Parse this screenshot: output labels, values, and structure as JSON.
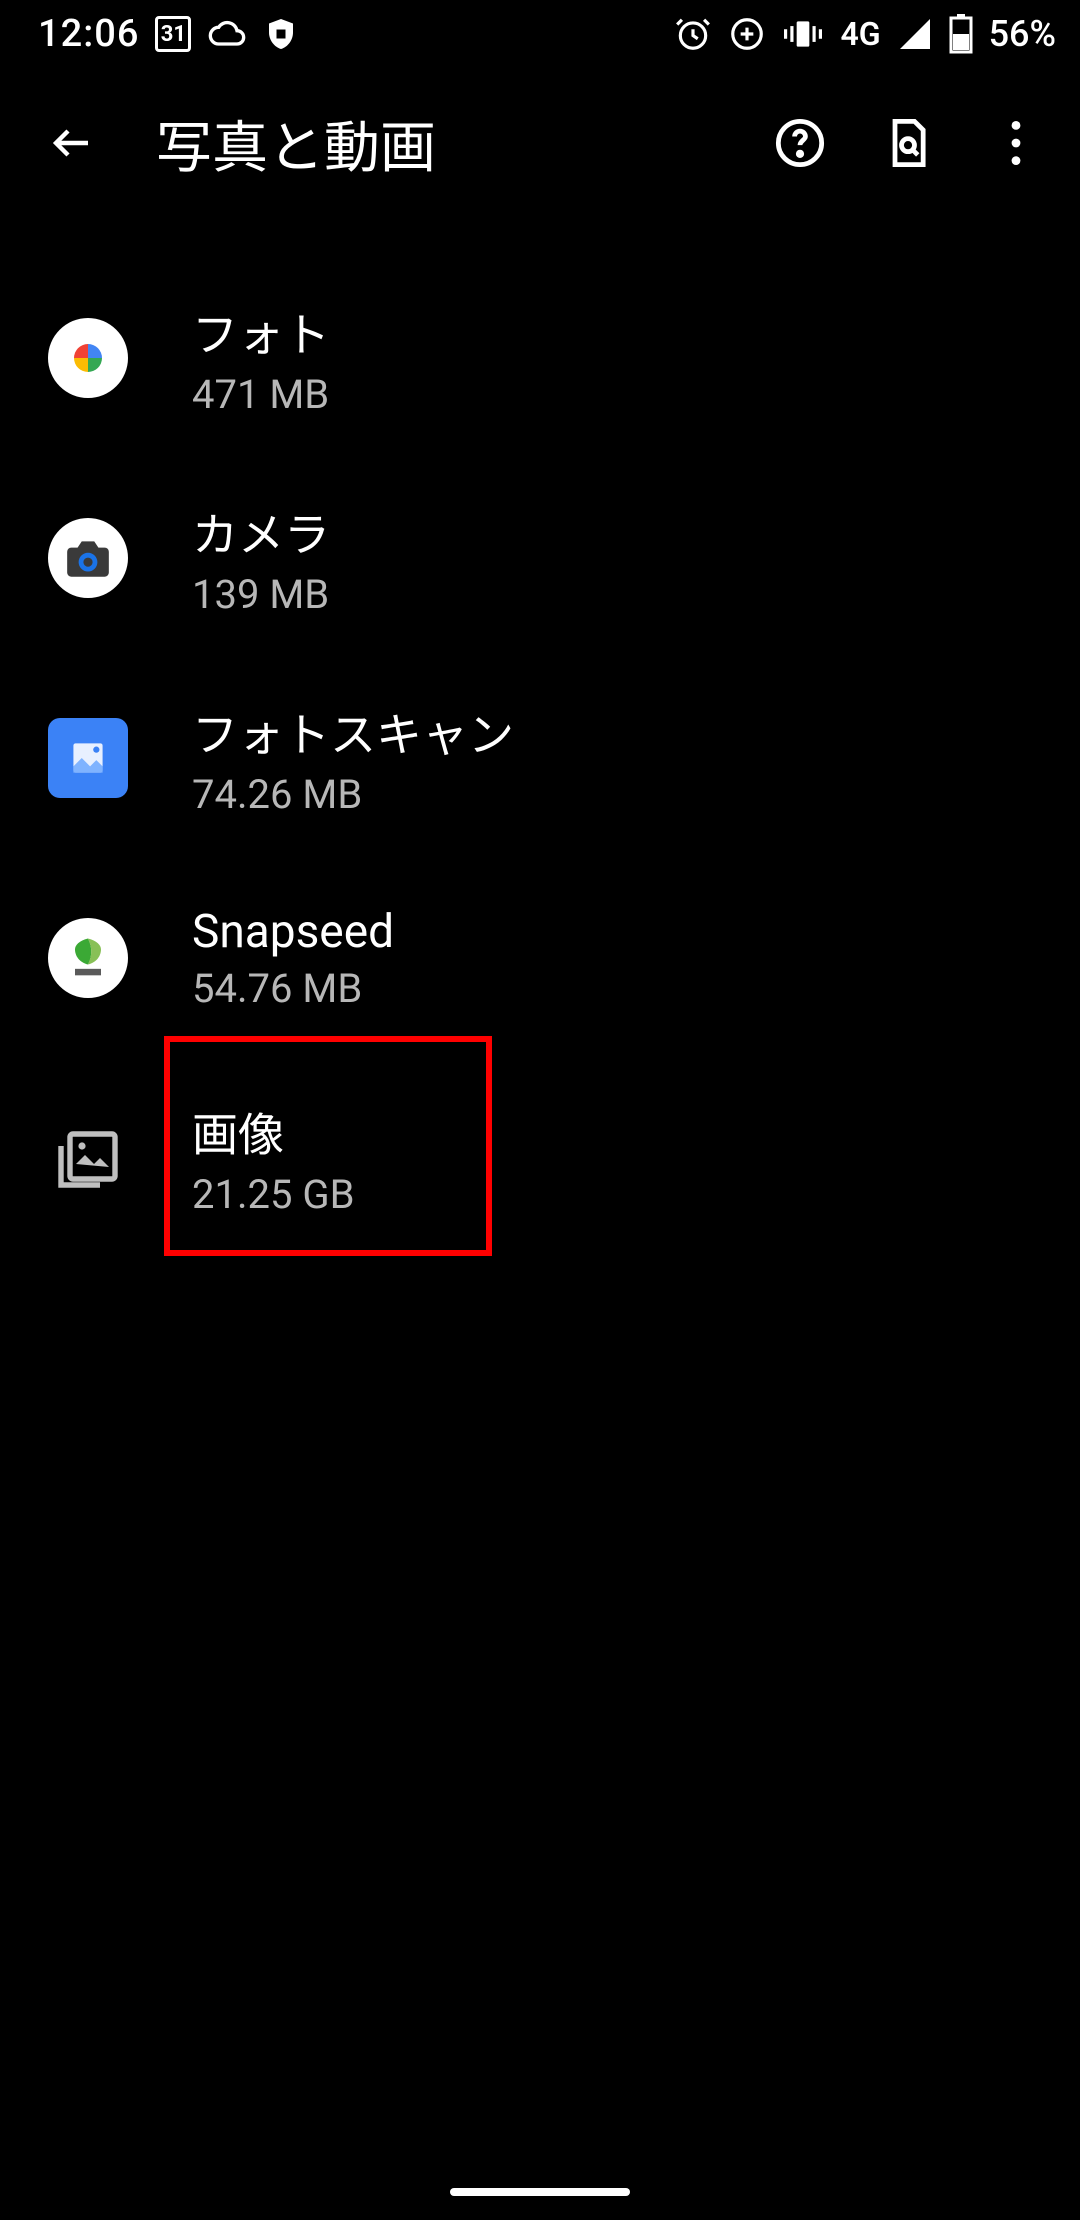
{
  "status": {
    "time": "12:06",
    "calendar_day": "31",
    "network": "4G",
    "battery": "56%"
  },
  "appbar": {
    "title": "写真と動画"
  },
  "items": [
    {
      "title": "フォト",
      "sub": "471 MB"
    },
    {
      "title": "カメラ",
      "sub": "139 MB"
    },
    {
      "title": "フォトスキャン",
      "sub": "74.26 MB"
    },
    {
      "title": "Snapseed",
      "sub": "54.76 MB"
    },
    {
      "title": "画像",
      "sub": "21.25 GB"
    }
  ]
}
